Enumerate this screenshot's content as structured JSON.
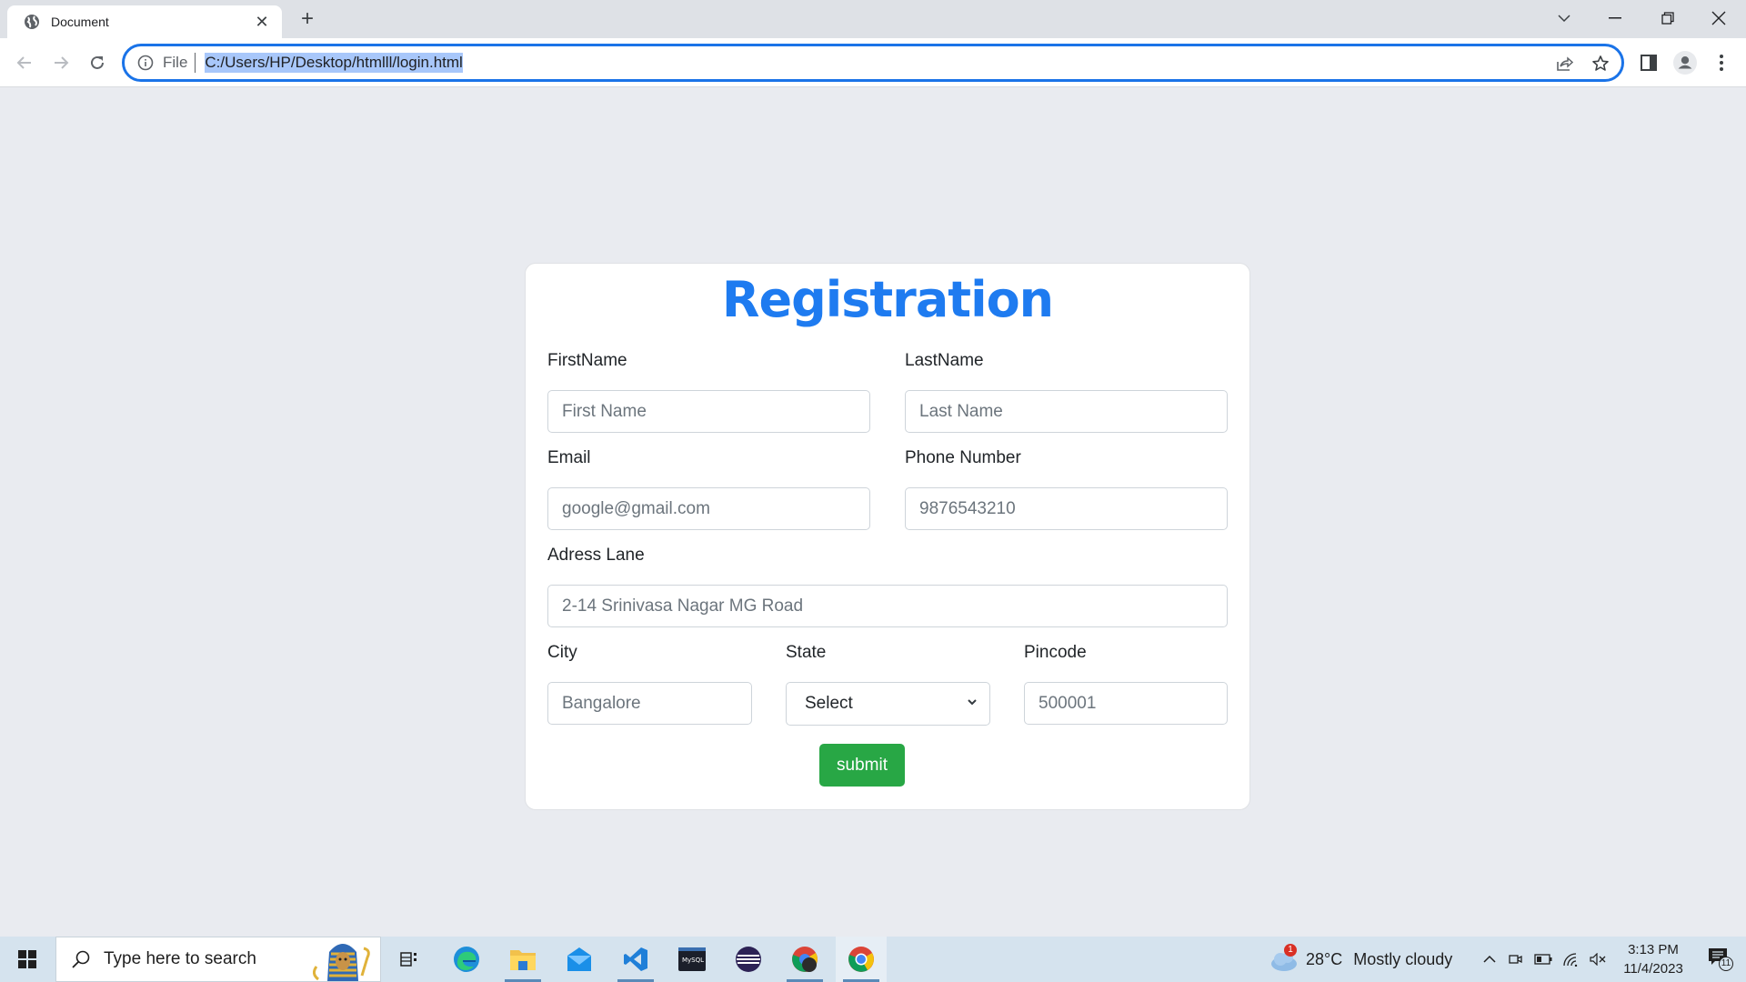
{
  "browser": {
    "tab_title": "Document",
    "tab_icon": "globe-icon",
    "url_scheme": "File",
    "url": "C:/Users/HP/Desktop/htmlll/login.html"
  },
  "form": {
    "title": "Registration",
    "accent_color": "#1e7bf0",
    "fields": {
      "first_name": {
        "label": "FirstName",
        "placeholder": "First Name"
      },
      "last_name": {
        "label": "LastName",
        "placeholder": "Last Name"
      },
      "email": {
        "label": "Email",
        "placeholder": "google@gmail.com"
      },
      "phone": {
        "label": "Phone Number",
        "placeholder": "9876543210"
      },
      "address": {
        "label": "Adress Lane",
        "placeholder": "2-14 Srinivasa Nagar MG Road"
      },
      "city": {
        "label": "City",
        "placeholder": "Bangalore"
      },
      "state": {
        "label": "State",
        "selected": "Select"
      },
      "pincode": {
        "label": "Pincode",
        "placeholder": "500001"
      }
    },
    "submit_label": "submit",
    "submit_color": "#28a745"
  },
  "taskbar": {
    "search_placeholder": "Type here to search",
    "apps": [
      "task-view",
      "edge",
      "file-explorer",
      "mail",
      "vscode",
      "mysql",
      "eclipse",
      "chrome-profile",
      "chrome"
    ],
    "weather": {
      "temp": "28°C",
      "condition": "Mostly cloudy",
      "badge": "1"
    },
    "time": "3:13 PM",
    "date": "11/4/2023",
    "notification_count": "11"
  }
}
